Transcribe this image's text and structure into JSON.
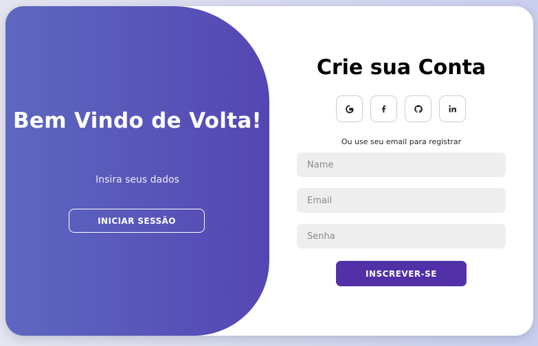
{
  "welcome": {
    "title": "Bem Vindo de Volta!",
    "subtitle": "Insira seus dados",
    "signin_button": "INICIAR SESSÃO"
  },
  "signup": {
    "title": "Crie sua Conta",
    "social_icons": [
      "google-icon",
      "facebook-icon",
      "github-icon",
      "linkedin-icon"
    ],
    "hint": "Ou use seu email para registrar",
    "fields": {
      "name_placeholder": "Name",
      "email_placeholder": "Email",
      "password_placeholder": "Senha"
    },
    "submit_button": "INSCREVER-SE"
  },
  "colors": {
    "panel_gradient_start": "#5c68c0",
    "panel_gradient_end": "#5546b3",
    "primary_button": "#5230a8",
    "input_background": "#eeeeee"
  }
}
